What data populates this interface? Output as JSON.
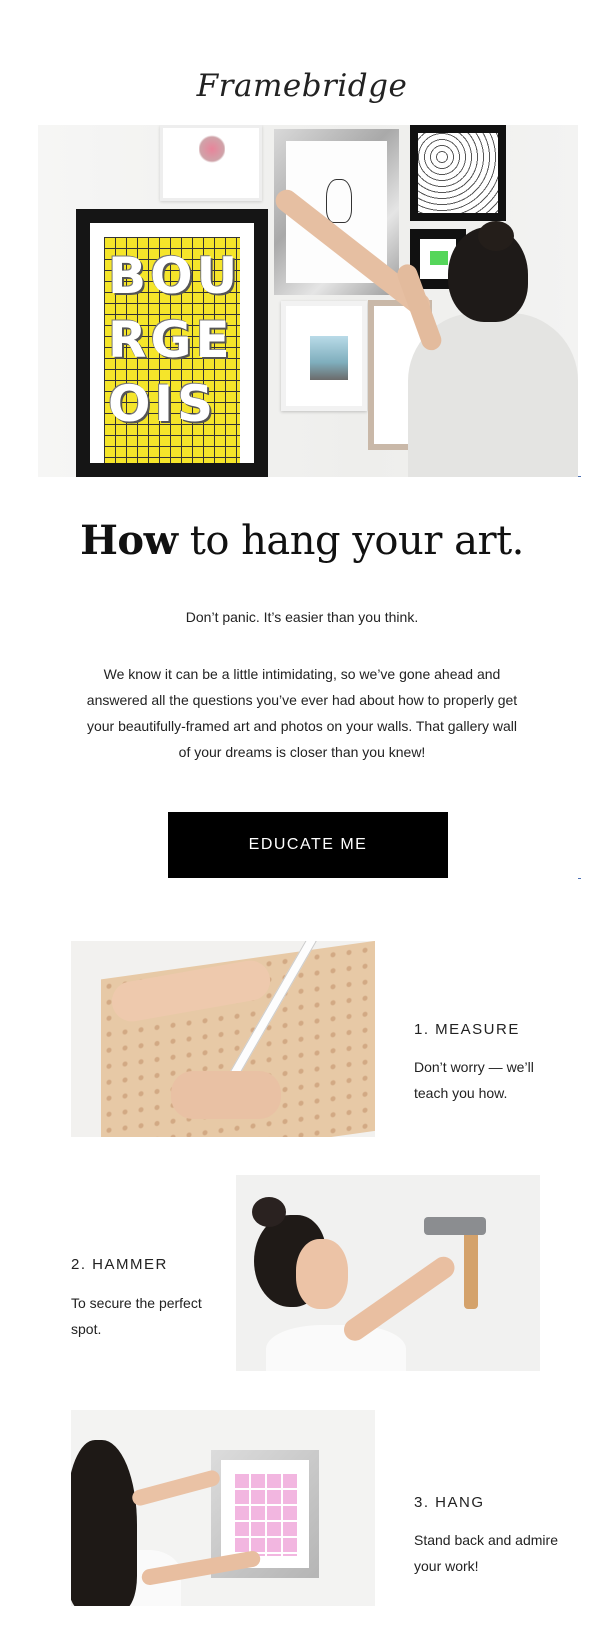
{
  "brand": {
    "logo_text": "Framebridge"
  },
  "hero": {
    "print_lines": [
      "BOU",
      "RGE",
      "OIS"
    ]
  },
  "headline": {
    "bold": "How",
    "rest": " to hang your art."
  },
  "subhead": "Don’t panic. It’s easier than you think.",
  "body": "We know it can be a little intimidating, so we’ve gone ahead and answered all the questions you’ve ever had about how to properly get your beautifully-framed art and photos on your walls. That gallery wall of your dreams is closer than you knew!",
  "cta": {
    "label": "EDUCATE ME"
  },
  "steps": [
    {
      "title": "1. MEASURE",
      "text": "Don’t worry — we’ll teach you how."
    },
    {
      "title": "2. HAMMER",
      "text": "To secure the perfect spot."
    },
    {
      "title": "3. HANG",
      "text": "Stand back and admire your work!"
    }
  ],
  "colors": {
    "cta_bg": "#000000",
    "cta_text": "#ffffff",
    "print_yellow": "#f5e52a"
  }
}
